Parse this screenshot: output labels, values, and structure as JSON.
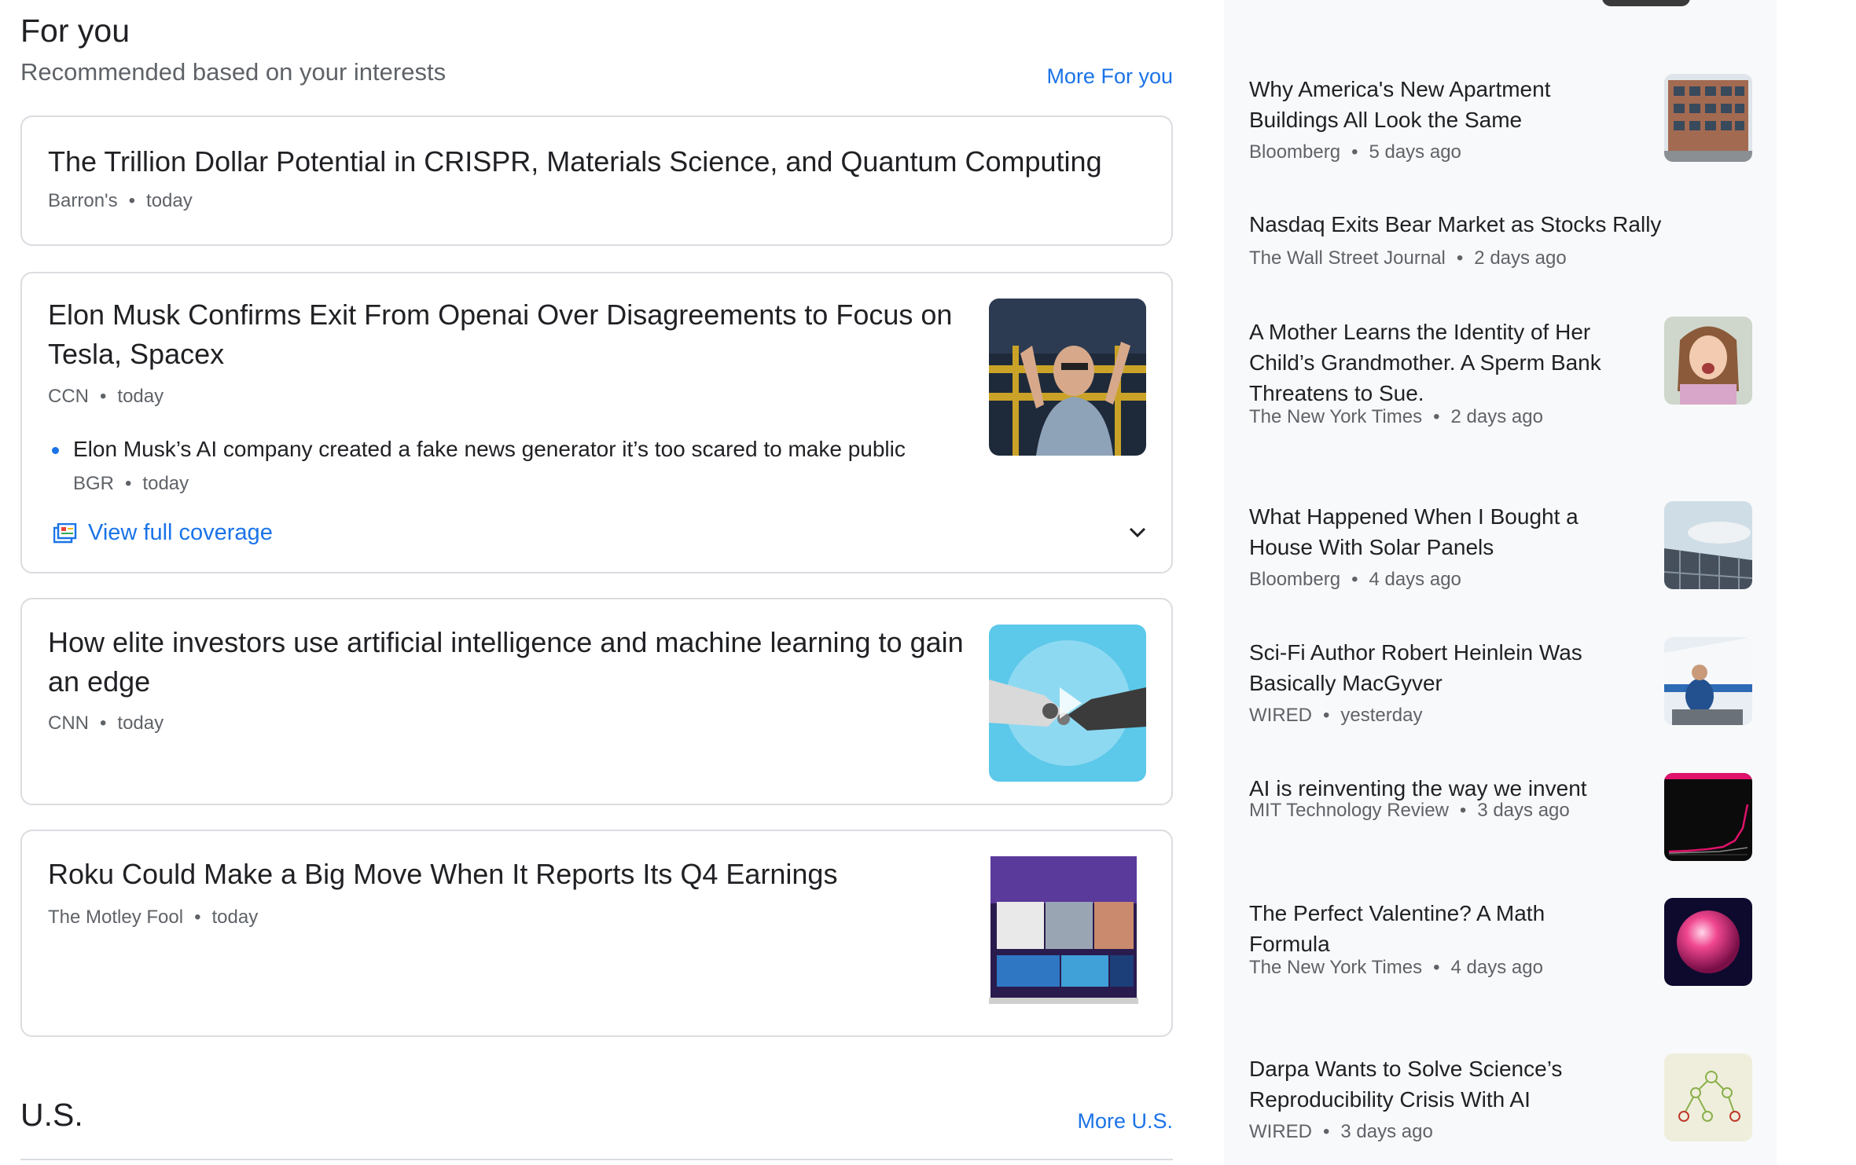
{
  "for_you": {
    "title": "For you",
    "subtitle": "Recommended based on your interests",
    "more_label": "More For you",
    "cards": [
      {
        "title": "The Trillion Dollar Potential in CRISPR, Materials Science, and Quantum Computing",
        "source": "Barron's",
        "time": "today"
      },
      {
        "title": "Elon Musk Confirms Exit From Openai Over Disagreements to Focus on Tesla, Spacex",
        "source": "CCN",
        "time": "today",
        "sub_story": {
          "title": "Elon Musk’s AI company created a fake news generator it’s too scared to make public",
          "source": "BGR",
          "time": "today"
        },
        "coverage_label": "View full coverage"
      },
      {
        "title": "How elite investors use artificial intelligence and machine learning to gain an edge",
        "source": "CNN",
        "time": "today"
      },
      {
        "title": "Roku Could Make a Big Move When It Reports Its Q4 Earnings",
        "source": "The Motley Fool",
        "time": "today"
      }
    ]
  },
  "us_section": {
    "title": "U.S.",
    "more_label": "More U.S."
  },
  "sidebar": {
    "items": [
      {
        "title": "Why America's New Apartment Buildings All Look the Same",
        "source": "Bloomberg",
        "time": "5 days ago",
        "icon": "apartment-building-thumbnail"
      },
      {
        "title": "Nasdaq Exits Bear Market as Stocks Rally",
        "source": "The Wall Street Journal",
        "time": "2 days ago"
      },
      {
        "title": "A Mother Learns the Identity of Her Child’s Grandmother. A Sperm Bank Threatens to Sue.",
        "source": "The New York Times",
        "time": "2 days ago",
        "icon": "child-photo-thumbnail"
      },
      {
        "title": "What Happened When I Bought a House With Solar Panels",
        "source": "Bloomberg",
        "time": "4 days ago",
        "icon": "solar-panel-thumbnail"
      },
      {
        "title": "Sci-Fi Author Robert Heinlein Was Basically MacGyver",
        "source": "WIRED",
        "time": "yesterday",
        "icon": "aircraft-mechanic-thumbnail"
      },
      {
        "title": "AI is reinventing the way we invent",
        "source": "MIT Technology Review",
        "time": "3 days ago",
        "icon": "chart-thumbnail"
      },
      {
        "title": "The Perfect Valentine? A Math Formula",
        "source": "The New York Times",
        "time": "4 days ago",
        "icon": "pink-sphere-thumbnail"
      },
      {
        "title": "Darpa Wants to Solve Science’s Reproducibility Crisis With AI",
        "source": "WIRED",
        "time": "3 days ago",
        "icon": "network-diagram-thumbnail"
      }
    ]
  }
}
